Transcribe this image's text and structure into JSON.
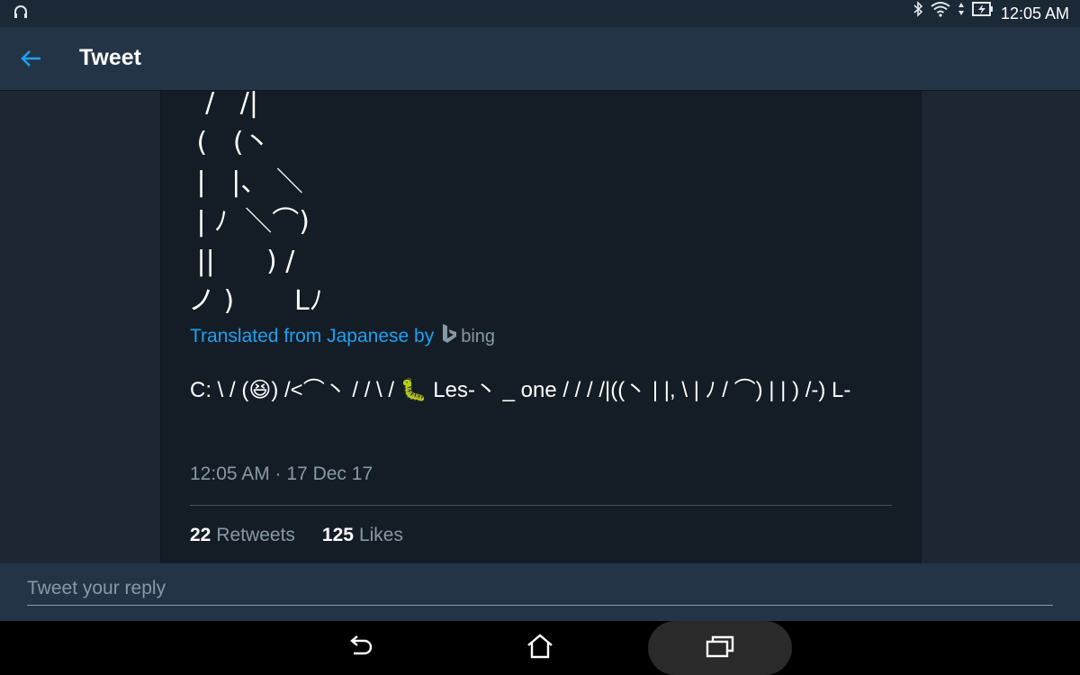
{
  "status_bar": {
    "time": "12:05 AM",
    "left_icon": "headset-icon",
    "icons": [
      "bluetooth-icon",
      "wifi-icon",
      "battery-charging-icon"
    ]
  },
  "header": {
    "title": "Tweet",
    "back_icon": "back-arrow-icon"
  },
  "tweet": {
    "ascii_art": "  /   /|\n (   (丶\n |   |、 ＼\n | ﾉ  ＼⌒)\n ||      ) /\nノ )       Lﾉ",
    "translated_label": "Translated from Japanese by",
    "translator": "bing",
    "translation_text": "C: \\ / (😆) /<⌒丶 / / \\ / 🐛 Les-丶 _ one / / / /|((丶 | |, \\ | ﾉ  / ⌒) | | ) /-) L-",
    "timestamp": "12:05 AM · 17 Dec 17",
    "retweets_count": "22",
    "retweets_label": "Retweets",
    "likes_count": "125",
    "likes_label": "Likes"
  },
  "reply": {
    "placeholder": "Tweet your reply"
  },
  "nav_bar": {
    "icons": [
      "nav-back-icon",
      "nav-home-icon",
      "nav-recents-icon"
    ]
  },
  "colors": {
    "background": "#141d26",
    "app_bar": "#243447",
    "accent": "#1da1f2",
    "muted_text": "#8899a6"
  }
}
